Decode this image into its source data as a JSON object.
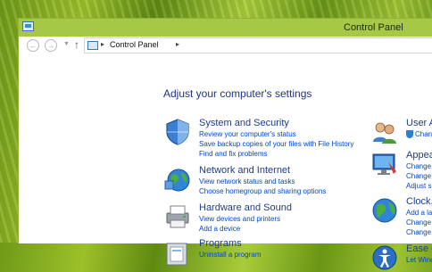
{
  "window": {
    "title": "Control Panel"
  },
  "address": {
    "crumb": "Control Panel",
    "separator": "▸"
  },
  "heading": "Adjust your computer's settings",
  "left_categories": [
    {
      "title": "System and Security",
      "links": [
        "Review your computer's status",
        "Save backup copies of your files with File History",
        "Find and fix problems"
      ]
    },
    {
      "title": "Network and Internet",
      "links": [
        "View network status and tasks",
        "Choose homegroup and sharing options"
      ]
    },
    {
      "title": "Hardware and Sound",
      "links": [
        "View devices and printers",
        "Add a device"
      ]
    },
    {
      "title": "Programs",
      "links": [
        "Uninstall a program"
      ]
    }
  ],
  "right_categories": [
    {
      "title": "User A",
      "links": [
        "Change"
      ]
    },
    {
      "title": "Appea",
      "links": [
        "Change",
        "Change",
        "Adjust s"
      ]
    },
    {
      "title": "Clock,",
      "links": [
        "Add a la",
        "Change",
        "Change"
      ]
    },
    {
      "title": "Ease o",
      "links": [
        "Let Wind"
      ]
    }
  ]
}
